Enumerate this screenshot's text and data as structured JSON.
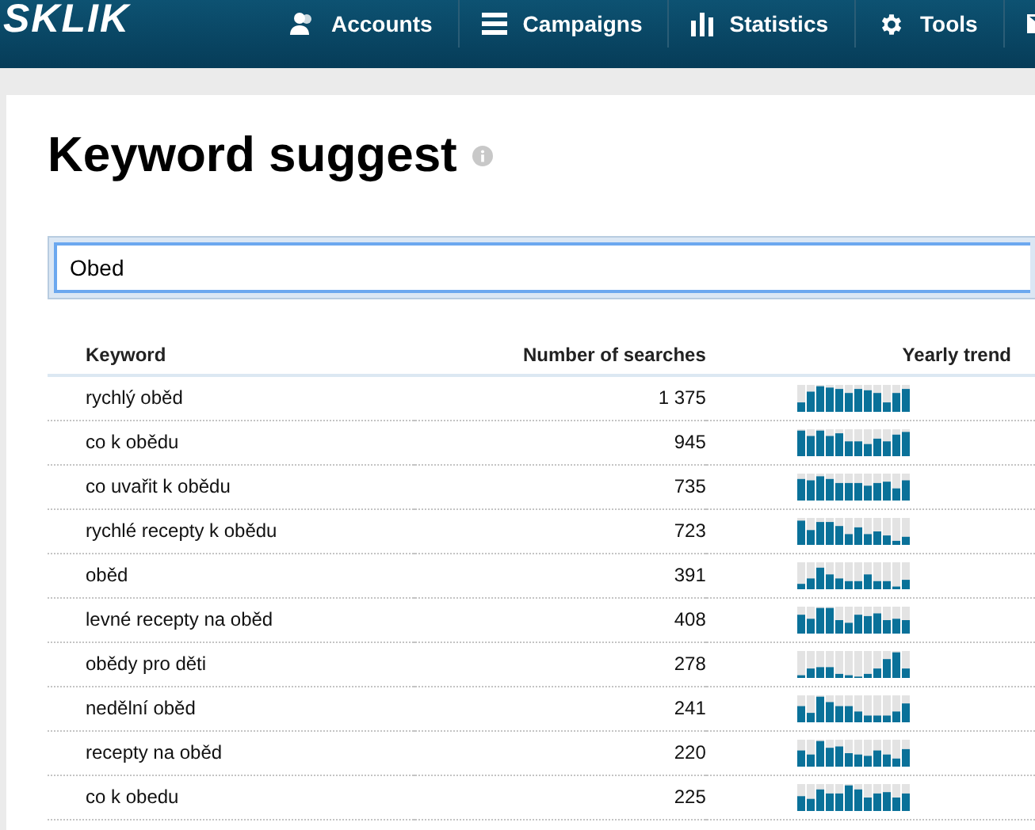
{
  "header": {
    "logo": "SKLIK",
    "nav": [
      {
        "label": "Accounts",
        "kind": "accounts"
      },
      {
        "label": "Campaigns",
        "kind": "campaigns"
      },
      {
        "label": "Statistics",
        "kind": "statistics"
      },
      {
        "label": "Tools",
        "kind": "tools"
      },
      {
        "kind": "mail"
      }
    ]
  },
  "page": {
    "title": "Keyword suggest"
  },
  "search": {
    "value": "Obed"
  },
  "table": {
    "columns": [
      "Keyword",
      "Number of searches",
      "Yearly trend"
    ],
    "rows": [
      {
        "keyword": "rychlý oběd",
        "searches": "1 375"
      },
      {
        "keyword": "co k obědu",
        "searches": "945"
      },
      {
        "keyword": "co uvařit k obědu",
        "searches": "735"
      },
      {
        "keyword": "rychlé recepty k obědu",
        "searches": "723"
      },
      {
        "keyword": "oběd",
        "searches": "391"
      },
      {
        "keyword": "levné recepty na oběd",
        "searches": "408"
      },
      {
        "keyword": "obědy pro děti",
        "searches": "278"
      },
      {
        "keyword": "nedělní oběd",
        "searches": "241"
      },
      {
        "keyword": "recepty na oběd",
        "searches": "220"
      },
      {
        "keyword": "co k obedu",
        "searches": "225"
      }
    ]
  }
}
